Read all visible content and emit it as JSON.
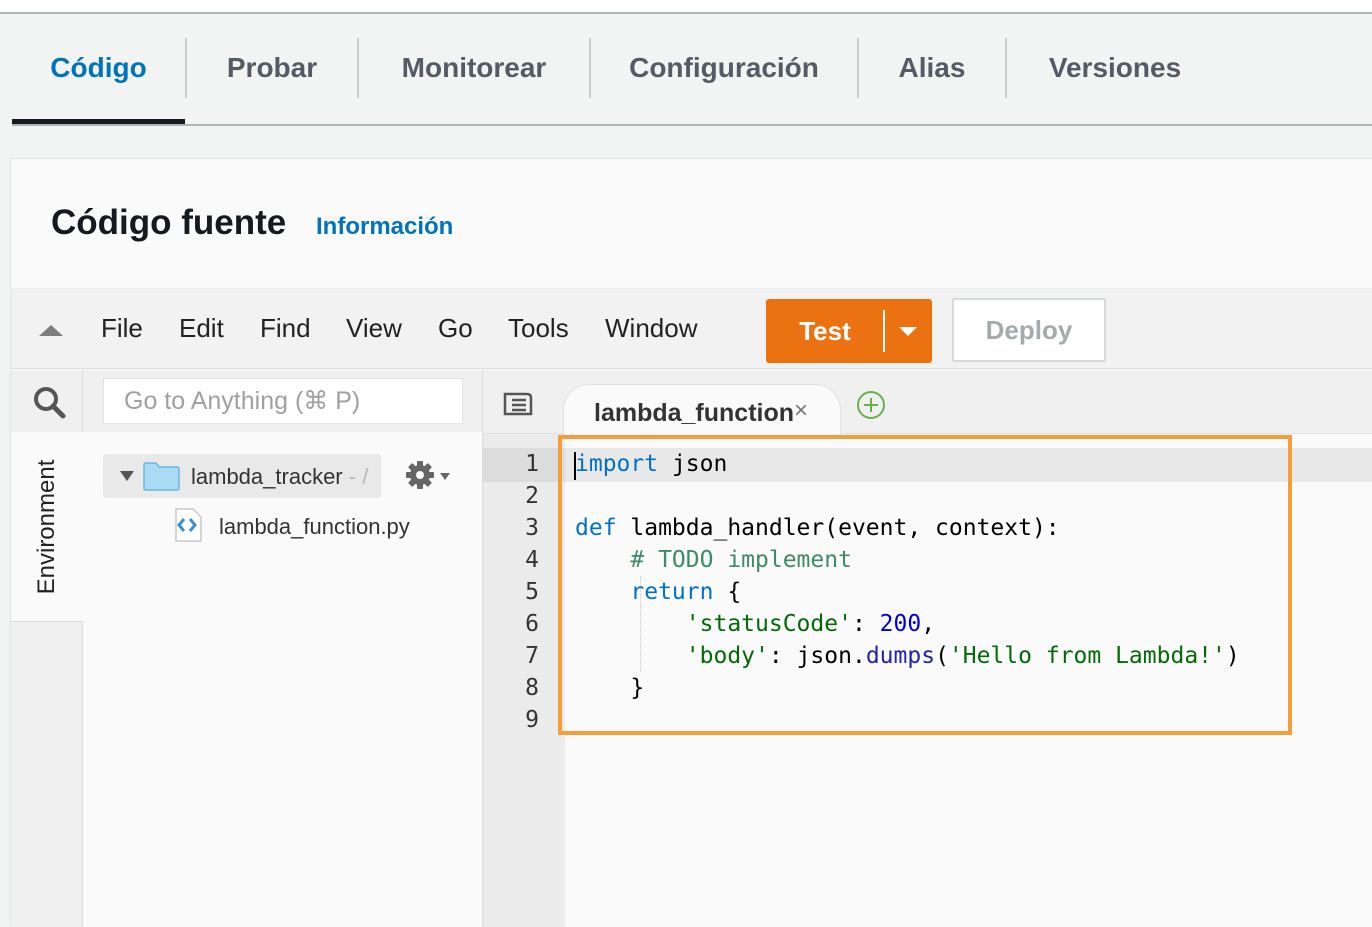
{
  "tabs": [
    {
      "label": "Código",
      "active": true
    },
    {
      "label": "Probar"
    },
    {
      "label": "Monitorear"
    },
    {
      "label": "Configuración"
    },
    {
      "label": "Alias"
    },
    {
      "label": "Versiones"
    }
  ],
  "panel": {
    "title": "Código fuente",
    "info_link": "Información"
  },
  "menubar": {
    "items": [
      "File",
      "Edit",
      "Find",
      "View",
      "Go",
      "Tools",
      "Window"
    ],
    "test_label": "Test",
    "deploy_label": "Deploy",
    "test_color": "#ec7211"
  },
  "sidebar": {
    "environment_label": "Environment",
    "search_placeholder": "Go to Anything (⌘ P)",
    "folder_name": "lambda_tracker",
    "folder_suffix": " - /",
    "file_name": "lambda_function.py"
  },
  "editor": {
    "open_tab": "lambda_function",
    "close_glyph": "×",
    "line_numbers": [
      "1",
      "2",
      "3",
      "4",
      "5",
      "6",
      "7",
      "8",
      "9"
    ]
  },
  "icons": {
    "collapse": "triangle-up-icon",
    "search": "search-icon",
    "folder": "folder-icon",
    "gear": "gear-icon",
    "file": "python-file-icon",
    "tab_list": "tab-list-icon",
    "add_tab": "add-tab-icon",
    "dropdown": "caret-down-icon"
  },
  "highlight_color": "#f59d3a"
}
